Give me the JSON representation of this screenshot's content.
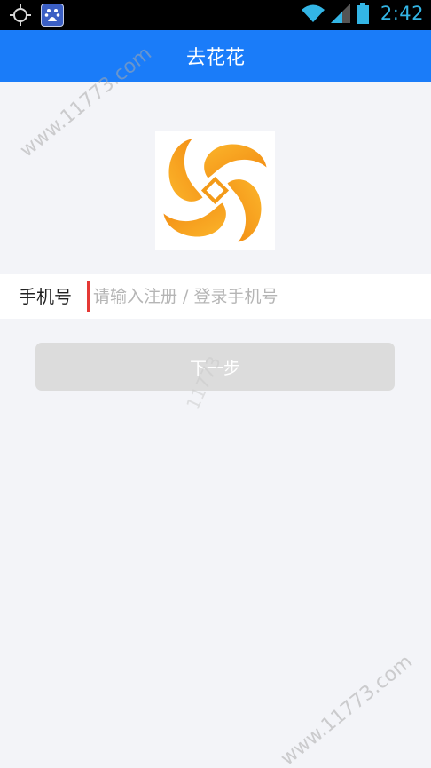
{
  "status_bar": {
    "time": "2:42",
    "left_icons": [
      "gps-icon",
      "baidu-icon"
    ],
    "right_icons": [
      "wifi-icon",
      "signal-icon",
      "battery-icon"
    ],
    "clock_color": "#33b5e5"
  },
  "app_bar": {
    "title": "去花花",
    "color": "#1a7cf9"
  },
  "logo": {
    "icon": "app-logo-icon",
    "colors": [
      "#f7a51f",
      "#f28a12"
    ]
  },
  "form": {
    "phone_label": "手机号",
    "phone_placeholder": "请输入注册 / 登录手机号",
    "phone_value": ""
  },
  "next_button": {
    "label": "下一步",
    "state": "disabled",
    "color": "#dcdcdc"
  },
  "watermark": {
    "text_top": "www.11773.com",
    "text_mid": "11773",
    "text_bottom": "www.11773.com"
  }
}
